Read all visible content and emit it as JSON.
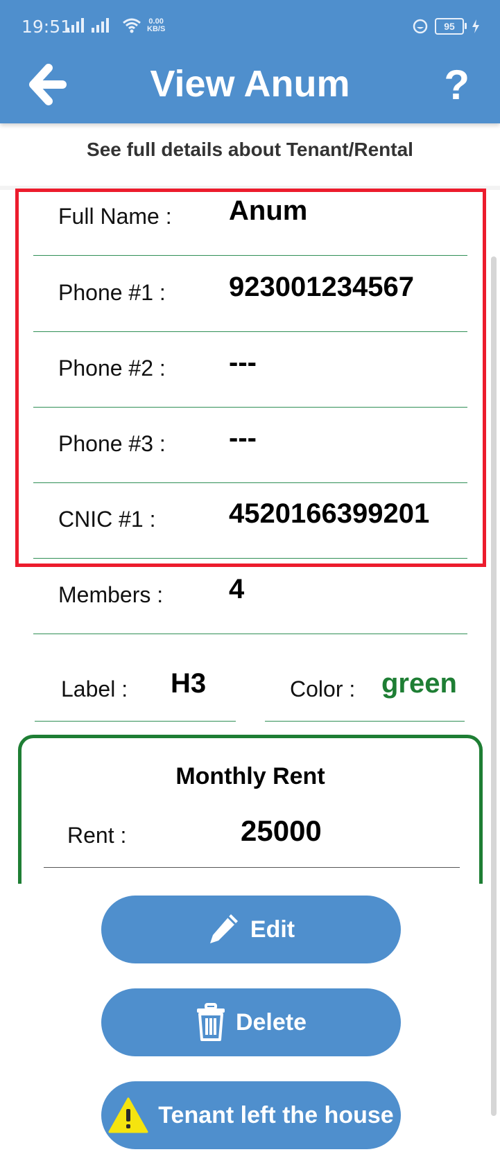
{
  "status_bar": {
    "time": "19:51",
    "net_speed_value": "0.00",
    "net_speed_unit": "KB/S",
    "battery": "95"
  },
  "app_bar": {
    "title": "View Anum",
    "back_icon": "arrow-left-icon",
    "help_icon": "question-mark-icon",
    "help_label": "?"
  },
  "subtitle": "See full details about Tenant/Rental",
  "details": {
    "full_name_label": "Full Name :",
    "full_name_value": "Anum",
    "phone1_label": "Phone #1 :",
    "phone1_value": "923001234567",
    "phone2_label": "Phone #2 :",
    "phone2_value": "---",
    "phone3_label": "Phone #3 :",
    "phone3_value": "---",
    "cnic1_label": "CNIC #1 :",
    "cnic1_value": "4520166399201",
    "members_label": "Members :",
    "members_value": "4",
    "label_label": "Label :",
    "label_value": "H3",
    "color_label": "Color :",
    "color_value": "green"
  },
  "rent": {
    "title": "Monthly Rent",
    "label": "Rent :",
    "value": "25000"
  },
  "buttons": {
    "edit": "Edit",
    "delete": "Delete",
    "left": "Tenant left the house"
  },
  "colors": {
    "primary": "#4f8fcd",
    "highlight": "#ec1c2d",
    "accent_green": "#1e7e34",
    "warning": "#f5e40f"
  }
}
